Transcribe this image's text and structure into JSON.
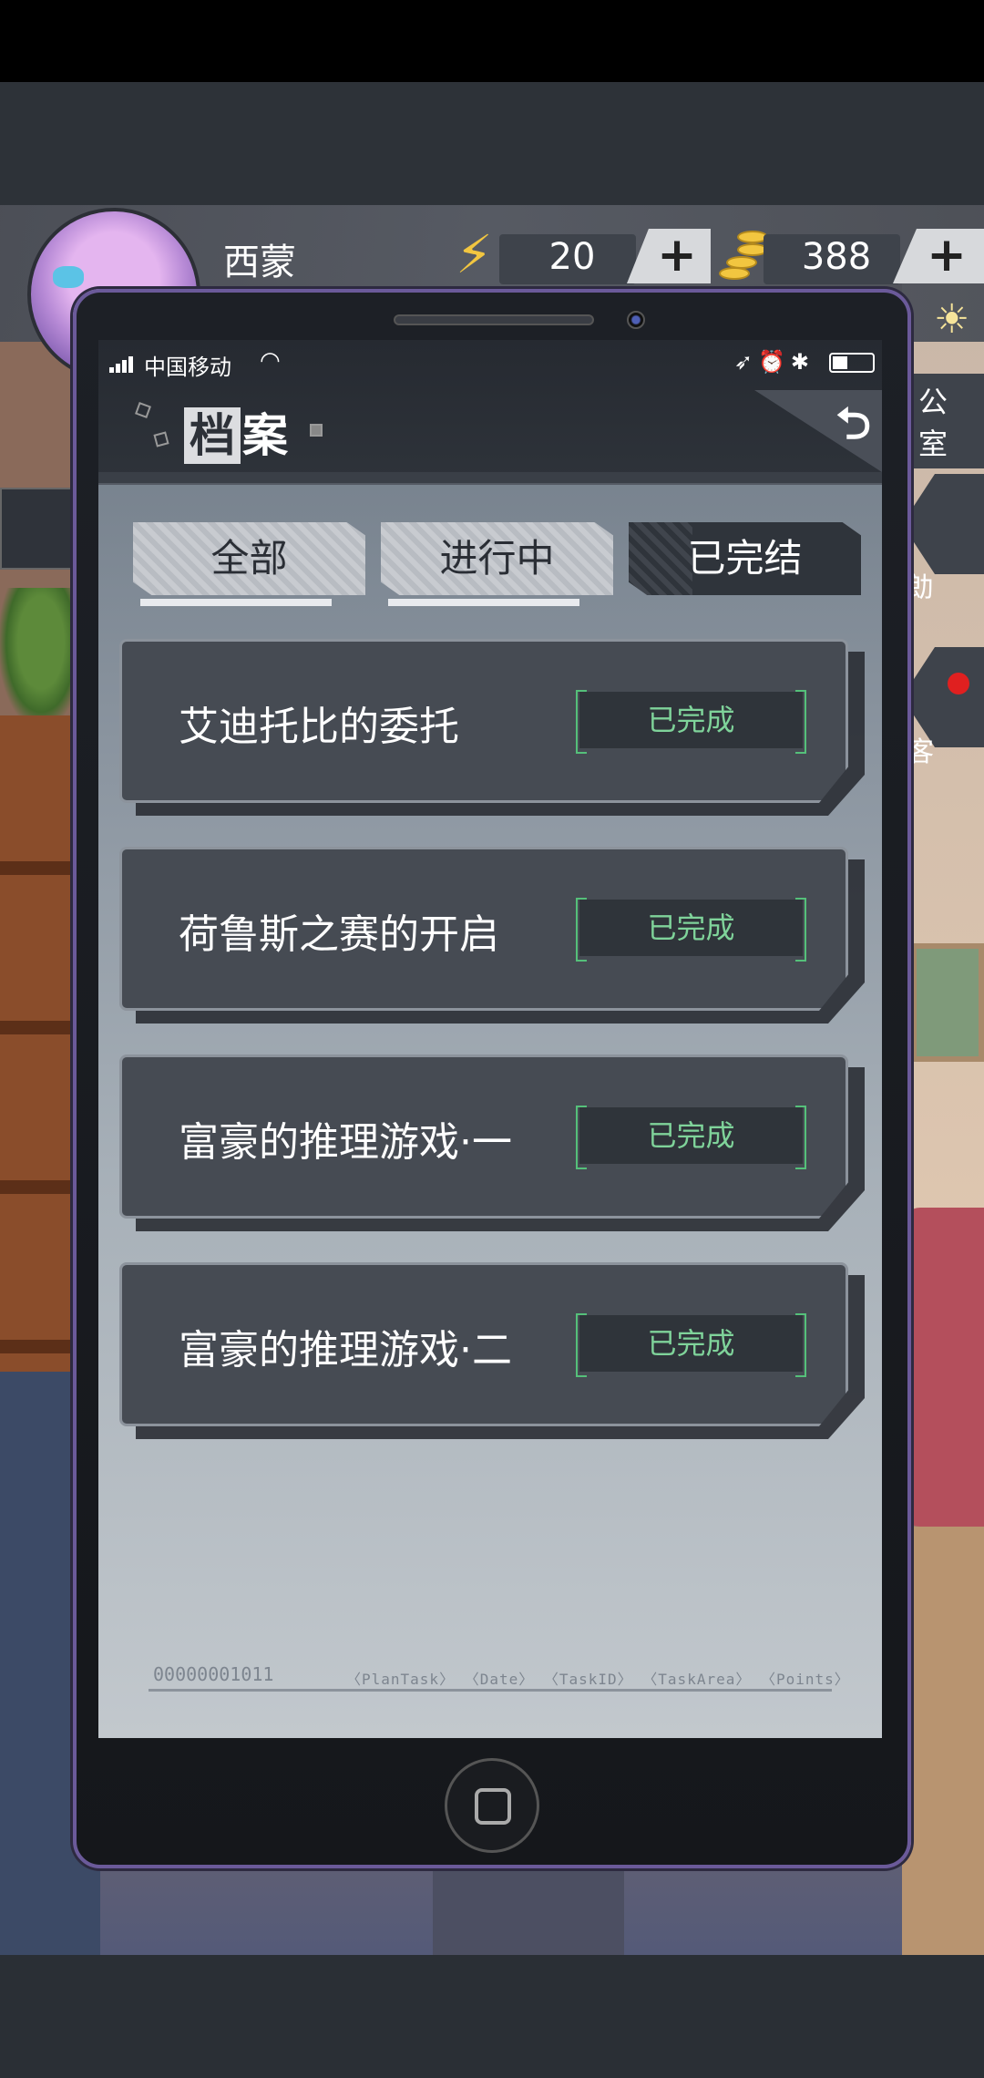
{
  "hud": {
    "player_name": "西蒙",
    "energy_value": "20",
    "coin_value": "388",
    "plus_label": "+",
    "side_label_office": "公室",
    "side_label_help": "勆",
    "side_label_2": "客",
    "icons": {
      "energy": "lightning-icon",
      "coins": "coin-stack-icon",
      "sun": "sun-icon"
    }
  },
  "statusbar": {
    "carrier": "中国移动"
  },
  "archive": {
    "title_first": "档",
    "title_rest": "案",
    "tabs": [
      "全部",
      "进行中",
      "已完结"
    ],
    "active_tab": "已完结",
    "tasks": [
      {
        "title": "艾迪托比的委托",
        "status": "已完成"
      },
      {
        "title": "荷鲁斯之赛的开启",
        "status": "已完成"
      },
      {
        "title": "富豪的推理游戏·一",
        "status": "已完成"
      },
      {
        "title": "富豪的推理游戏·二",
        "status": "已完成"
      }
    ],
    "footer_code": "00000001011",
    "footer_fields": "〈PlanTask〉 〈Date〉 〈TaskID〉 〈TaskArea〉 〈Points〉"
  },
  "colors": {
    "status_green": "#7fd39a",
    "phone_border": "#6b5a9a",
    "energy_yellow": "#f2c640"
  }
}
